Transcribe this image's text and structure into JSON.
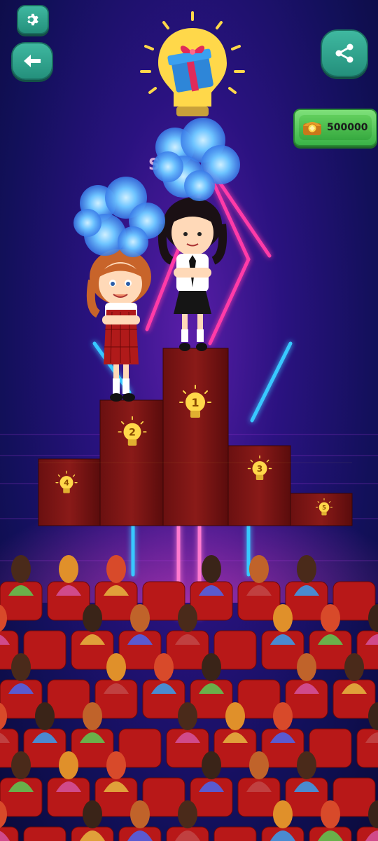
{
  "top_bar": {
    "settings_icon": "gear-icon",
    "back_icon": "arrow-left-icon",
    "share_icon": "share-icon",
    "hint_icon": "lightbulb-gift-icon"
  },
  "coins": {
    "icon": "coin-chest-icon",
    "value": "500000"
  },
  "podium": {
    "places": [
      "1",
      "2",
      "3",
      "4",
      "5"
    ],
    "icon": "lightbulb-icon"
  },
  "colors": {
    "button_teal": "#2fa38d",
    "coin_green": "#4cc04f",
    "podium_red": "#7a1414",
    "neon_pink": "#ff3aa8",
    "neon_cyan": "#39c8ff",
    "bulb_yellow": "#ffd84a"
  }
}
